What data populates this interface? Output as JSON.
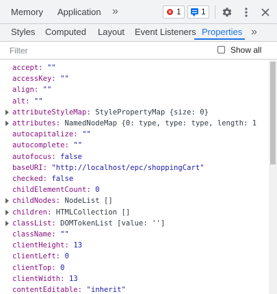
{
  "top_tabs": [
    "Memory",
    "Application"
  ],
  "more_panels_glyph": "»",
  "errors_count": "1",
  "messages_count": "1",
  "icons": {
    "settings": "gear-icon",
    "menu": "kebab-icon",
    "close": "close-icon"
  },
  "sub_tabs": [
    "Styles",
    "Computed",
    "Layout",
    "Event Listeners",
    "Properties"
  ],
  "active_sub_tab": "Properties",
  "filter": {
    "placeholder": "Filter",
    "value": ""
  },
  "show_all_label": "Show all",
  "show_all_checked": false,
  "colors": {
    "accent": "#1a73e8",
    "key": "#881280",
    "string": "#1a1aa6",
    "error": "#d93025"
  },
  "properties": [
    {
      "key": "accept",
      "value": "\"\"",
      "kind": "str",
      "expandable": false
    },
    {
      "key": "accessKey",
      "value": "\"\"",
      "kind": "str",
      "expandable": false
    },
    {
      "key": "align",
      "value": "\"\"",
      "kind": "str",
      "expandable": false
    },
    {
      "key": "alt",
      "value": "\"\"",
      "kind": "str",
      "expandable": false
    },
    {
      "key": "attributeStyleMap",
      "value": "StylePropertyMap {size: 0}",
      "kind": "obj",
      "expandable": true
    },
    {
      "key": "attributes",
      "value": "NamedNodeMap {0: type, type: type, length: 1",
      "kind": "obj",
      "expandable": true
    },
    {
      "key": "autocapitalize",
      "value": "\"\"",
      "kind": "str",
      "expandable": false
    },
    {
      "key": "autocomplete",
      "value": "\"\"",
      "kind": "str",
      "expandable": false
    },
    {
      "key": "autofocus",
      "value": "false",
      "kind": "num",
      "expandable": false
    },
    {
      "key": "baseURI",
      "value": "\"http://localhost/epc/shoppingCart\"",
      "kind": "str",
      "expandable": false
    },
    {
      "key": "checked",
      "value": "false",
      "kind": "num",
      "expandable": false
    },
    {
      "key": "childElementCount",
      "value": "0",
      "kind": "num",
      "expandable": false
    },
    {
      "key": "childNodes",
      "value": "NodeList []",
      "kind": "obj",
      "expandable": true
    },
    {
      "key": "children",
      "value": "HTMLCollection []",
      "kind": "obj",
      "expandable": true
    },
    {
      "key": "classList",
      "value": "DOMTokenList [value: '']",
      "kind": "obj",
      "expandable": true
    },
    {
      "key": "className",
      "value": "\"\"",
      "kind": "str",
      "expandable": false
    },
    {
      "key": "clientHeight",
      "value": "13",
      "kind": "num",
      "expandable": false
    },
    {
      "key": "clientLeft",
      "value": "0",
      "kind": "num",
      "expandable": false
    },
    {
      "key": "clientTop",
      "value": "0",
      "kind": "num",
      "expandable": false
    },
    {
      "key": "clientWidth",
      "value": "13",
      "kind": "num",
      "expandable": false
    },
    {
      "key": "contentEditable",
      "value": "\"inherit\"",
      "kind": "str",
      "expandable": false
    }
  ]
}
